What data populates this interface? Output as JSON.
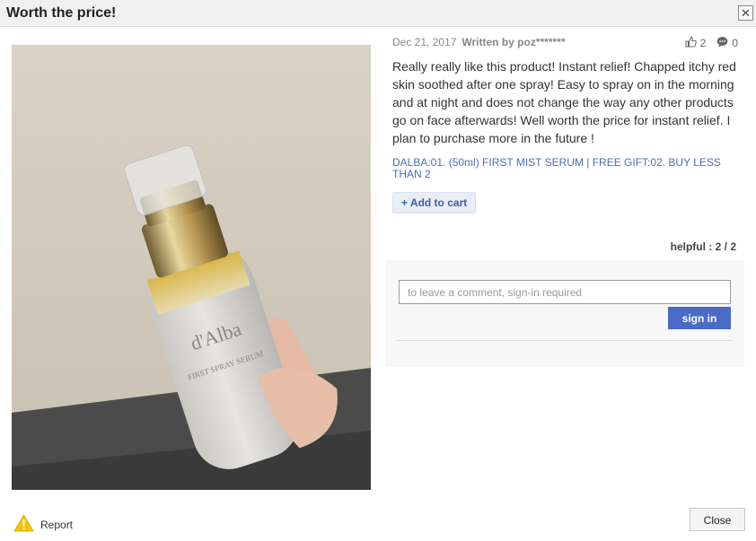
{
  "dialog": {
    "title": "Worth the price!",
    "close_x": "✕"
  },
  "review": {
    "date": "Dec 21, 2017",
    "author": "Written by poz*******",
    "likes": "2",
    "comments": "0",
    "text": "Really really like this product! Instant relief! Chapped itchy red skin soothed after one spray! Easy to spray on in the morning and at night and does not change the way any other products go on face afterwards! Well worth the price for instant relief. I plan to purchase more in the future !",
    "product_option": "DALBA:01. (50ml) FIRST MIST SERUM | FREE GIFT:02. BUY LESS THAN 2",
    "add_to_cart": "+ Add to cart",
    "helpful_label": "helpful : ",
    "helpful_value": "2 / 2",
    "photo_brand": "d'Alba",
    "photo_label": "FIRST SPRAY SERUM"
  },
  "comment": {
    "placeholder": "to leave a comment, sign-in required",
    "signin_label": "sign in"
  },
  "footer": {
    "report_label": "Report",
    "close_label": "Close"
  },
  "colors": {
    "accent": "#4a6bc6",
    "link": "#4a6fb5",
    "warning": "#f5c400"
  }
}
